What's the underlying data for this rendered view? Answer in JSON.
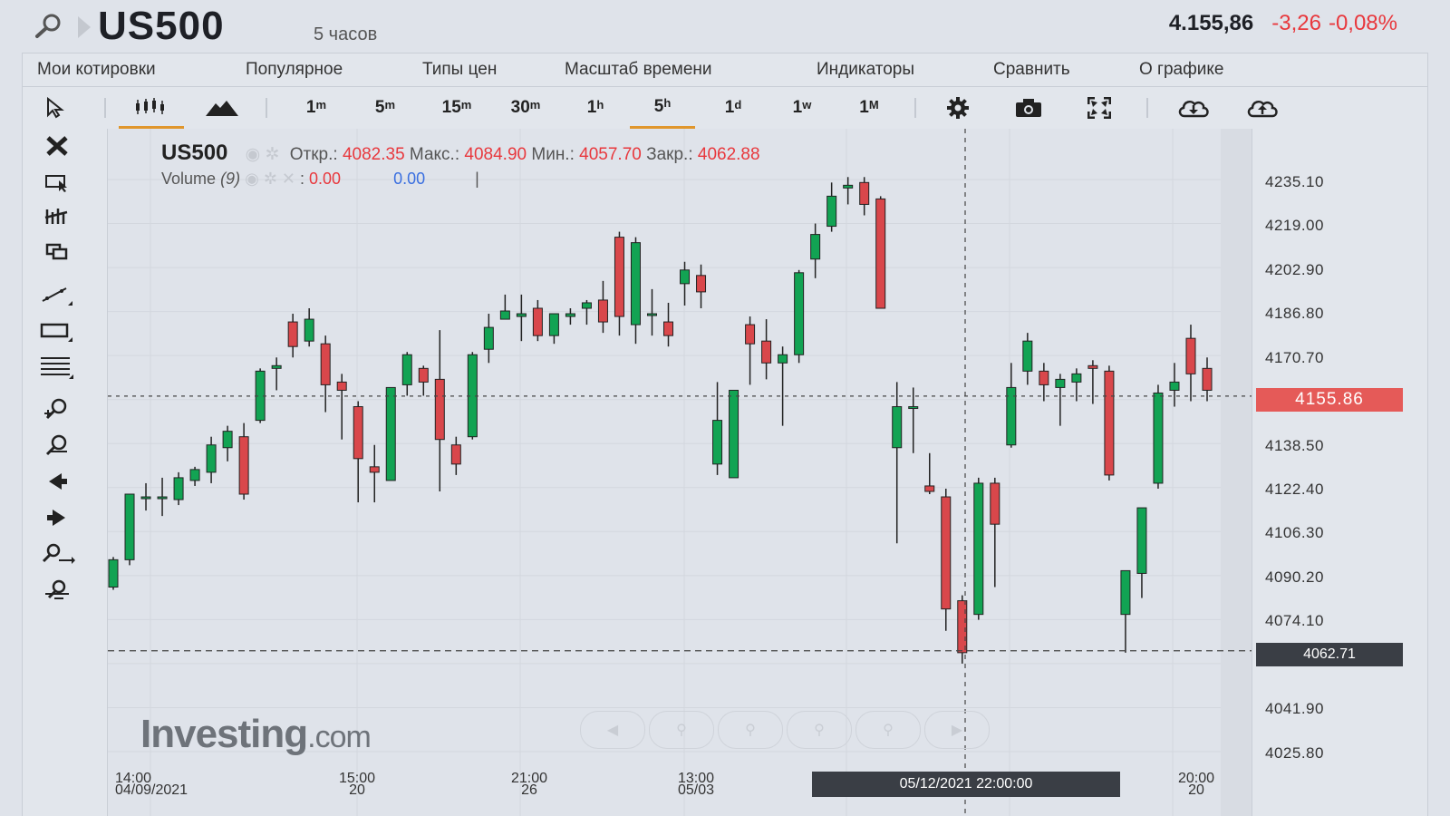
{
  "header": {
    "symbol": "US500",
    "timeframe": "5 часов",
    "price": "4.155,86",
    "change": "-3,26",
    "change_pct": "-0,08%"
  },
  "menu": [
    "Мои котировки",
    "Популярное",
    "Типы цен",
    "Масштаб времени",
    "Индикаторы",
    "Сравнить",
    "О графике"
  ],
  "toolbar": {
    "intervals": [
      {
        "num": "1",
        "unit": "m"
      },
      {
        "num": "5",
        "unit": "m"
      },
      {
        "num": "15",
        "unit": "m"
      },
      {
        "num": "30",
        "unit": "m"
      },
      {
        "num": "1",
        "unit": "h"
      },
      {
        "num": "5",
        "unit": "h"
      },
      {
        "num": "1",
        "unit": "d"
      },
      {
        "num": "1",
        "unit": "w"
      },
      {
        "num": "1",
        "unit": "M"
      }
    ],
    "active_interval": "5h"
  },
  "legend": {
    "symbol": "US500",
    "open_label": "Откр.:",
    "open": "4082.35",
    "high_label": "Макс.:",
    "high": "4084.90",
    "low_label": "Мин.:",
    "low": "4057.70",
    "close_label": "Закр.:",
    "close": "4062.88",
    "volume_label": "Volume",
    "volume_param": "(9)",
    "volume_a": "0.00",
    "volume_b": "0.00"
  },
  "price_axis": {
    "ticks": [
      "4235.10",
      "4219.00",
      "4202.90",
      "4186.80",
      "4170.70",
      "4138.50",
      "4122.40",
      "4106.30",
      "4090.20",
      "4074.10",
      "4041.90",
      "4025.80"
    ],
    "current_price": "4155.86",
    "crosshair_price": "4062.71"
  },
  "time_axis": {
    "ticks": [
      {
        "top": "14:00",
        "bottom": "04/09/2021"
      },
      {
        "top": "15:00",
        "bottom": "20"
      },
      {
        "top": "21:00",
        "bottom": "26"
      },
      {
        "top": "13:00",
        "bottom": "05/03"
      },
      {
        "top": "20:00",
        "bottom": "20"
      }
    ],
    "crosshair_date": "05/12/2021 22:00:00"
  },
  "watermark": {
    "main": "Investing",
    "suffix": ".com"
  },
  "colors": {
    "up": "#12a353",
    "down": "#d9474b",
    "price_tag": "#e55a58",
    "active": "#e0962c"
  },
  "chart_data": {
    "type": "candlestick",
    "symbol": "US500",
    "interval": "5h",
    "ylim": [
      4020,
      4245
    ],
    "crosshair_price": 4062.71,
    "current_price": 4155.86,
    "candles": [
      {
        "o": 4086,
        "h": 4097,
        "l": 4085,
        "c": 4096
      },
      {
        "o": 4096,
        "h": 4120,
        "l": 4094,
        "c": 4120
      },
      {
        "o": 4119,
        "h": 4124,
        "l": 4114,
        "c": 4119
      },
      {
        "o": 4119,
        "h": 4126,
        "l": 4112,
        "c": 4119
      },
      {
        "o": 4118,
        "h": 4128,
        "l": 4116,
        "c": 4126
      },
      {
        "o": 4125,
        "h": 4130,
        "l": 4123,
        "c": 4129
      },
      {
        "o": 4128,
        "h": 4141,
        "l": 4124,
        "c": 4138
      },
      {
        "o": 4137,
        "h": 4145,
        "l": 4132,
        "c": 4143
      },
      {
        "o": 4141,
        "h": 4146,
        "l": 4118,
        "c": 4120
      },
      {
        "o": 4147,
        "h": 4166,
        "l": 4146,
        "c": 4165
      },
      {
        "o": 4166,
        "h": 4170,
        "l": 4158,
        "c": 4167
      },
      {
        "o": 4183,
        "h": 4186,
        "l": 4170,
        "c": 4174
      },
      {
        "o": 4176,
        "h": 4188,
        "l": 4174,
        "c": 4184
      },
      {
        "o": 4175,
        "h": 4178,
        "l": 4150,
        "c": 4160
      },
      {
        "o": 4161,
        "h": 4164,
        "l": 4140,
        "c": 4158
      },
      {
        "o": 4152,
        "h": 4154,
        "l": 4117,
        "c": 4133
      },
      {
        "o": 4130,
        "h": 4138,
        "l": 4117,
        "c": 4128
      },
      {
        "o": 4125,
        "h": 4159,
        "l": 4125,
        "c": 4159
      },
      {
        "o": 4160,
        "h": 4172,
        "l": 4156,
        "c": 4171
      },
      {
        "o": 4166,
        "h": 4167,
        "l": 4156,
        "c": 4161
      },
      {
        "o": 4162,
        "h": 4180,
        "l": 4121,
        "c": 4140
      },
      {
        "o": 4138,
        "h": 4141,
        "l": 4127,
        "c": 4131
      },
      {
        "o": 4141,
        "h": 4172,
        "l": 4140,
        "c": 4171
      },
      {
        "o": 4173,
        "h": 4186,
        "l": 4168,
        "c": 4181
      },
      {
        "o": 4184,
        "h": 4193,
        "l": 4184,
        "c": 4187
      },
      {
        "o": 4185,
        "h": 4193,
        "l": 4176,
        "c": 4186
      },
      {
        "o": 4188,
        "h": 4191,
        "l": 4176,
        "c": 4178
      },
      {
        "o": 4178,
        "h": 4184,
        "l": 4175,
        "c": 4186
      },
      {
        "o": 4185,
        "h": 4188,
        "l": 4182,
        "c": 4186
      },
      {
        "o": 4188,
        "h": 4191,
        "l": 4182,
        "c": 4190
      },
      {
        "o": 4191,
        "h": 4198,
        "l": 4179,
        "c": 4183
      },
      {
        "o": 4214,
        "h": 4216,
        "l": 4178,
        "c": 4185
      },
      {
        "o": 4182,
        "h": 4214,
        "l": 4175,
        "c": 4212
      },
      {
        "o": 4186,
        "h": 4195,
        "l": 4178,
        "c": 4186
      },
      {
        "o": 4183,
        "h": 4190,
        "l": 4174,
        "c": 4178
      },
      {
        "o": 4197,
        "h": 4205,
        "l": 4189,
        "c": 4202
      },
      {
        "o": 4200,
        "h": 4204,
        "l": 4188,
        "c": 4194
      },
      {
        "o": 4131,
        "h": 4161,
        "l": 4127,
        "c": 4147
      },
      {
        "o": 4126,
        "h": 4158,
        "l": 4126,
        "c": 4158
      },
      {
        "o": 4182,
        "h": 4185,
        "l": 4160,
        "c": 4175
      },
      {
        "o": 4176,
        "h": 4184,
        "l": 4162,
        "c": 4168
      },
      {
        "o": 4168,
        "h": 4174,
        "l": 4145,
        "c": 4171
      },
      {
        "o": 4171,
        "h": 4202,
        "l": 4168,
        "c": 4201
      },
      {
        "o": 4206,
        "h": 4219,
        "l": 4199,
        "c": 4215
      },
      {
        "o": 4218,
        "h": 4234,
        "l": 4216,
        "c": 4229
      },
      {
        "o": 4232,
        "h": 4236,
        "l": 4226,
        "c": 4233
      },
      {
        "o": 4234,
        "h": 4236,
        "l": 4222,
        "c": 4226
      },
      {
        "o": 4228,
        "h": 4229,
        "l": 4188,
        "c": 4188
      },
      {
        "o": 4137,
        "h": 4161,
        "l": 4102,
        "c": 4152
      },
      {
        "o": 4152,
        "h": 4159,
        "l": 4135,
        "c": 4152
      },
      {
        "o": 4123,
        "h": 4135,
        "l": 4120,
        "c": 4121
      },
      {
        "o": 4119,
        "h": 4122,
        "l": 4070,
        "c": 4078
      },
      {
        "o": 4081,
        "h": 4083,
        "l": 4058,
        "c": 4062
      },
      {
        "o": 4076,
        "h": 4126,
        "l": 4074,
        "c": 4124
      },
      {
        "o": 4124,
        "h": 4126,
        "l": 4086,
        "c": 4109
      },
      {
        "o": 4138,
        "h": 4168,
        "l": 4137,
        "c": 4159
      },
      {
        "o": 4165,
        "h": 4179,
        "l": 4160,
        "c": 4176
      },
      {
        "o": 4165,
        "h": 4168,
        "l": 4154,
        "c": 4160
      },
      {
        "o": 4159,
        "h": 4164,
        "l": 4145,
        "c": 4162
      },
      {
        "o": 4161,
        "h": 4166,
        "l": 4154,
        "c": 4164
      },
      {
        "o": 4167,
        "h": 4169,
        "l": 4153,
        "c": 4166
      },
      {
        "o": 4165,
        "h": 4167,
        "l": 4125,
        "c": 4127
      },
      {
        "o": 4076,
        "h": 4091,
        "l": 4062,
        "c": 4092
      },
      {
        "o": 4091,
        "h": 4111,
        "l": 4082,
        "c": 4115
      },
      {
        "o": 4124,
        "h": 4160,
        "l": 4122,
        "c": 4157
      },
      {
        "o": 4158,
        "h": 4168,
        "l": 4152,
        "c": 4161
      },
      {
        "o": 4177,
        "h": 4182,
        "l": 4154,
        "c": 4164
      },
      {
        "o": 4166,
        "h": 4170,
        "l": 4154,
        "c": 4158
      }
    ]
  }
}
